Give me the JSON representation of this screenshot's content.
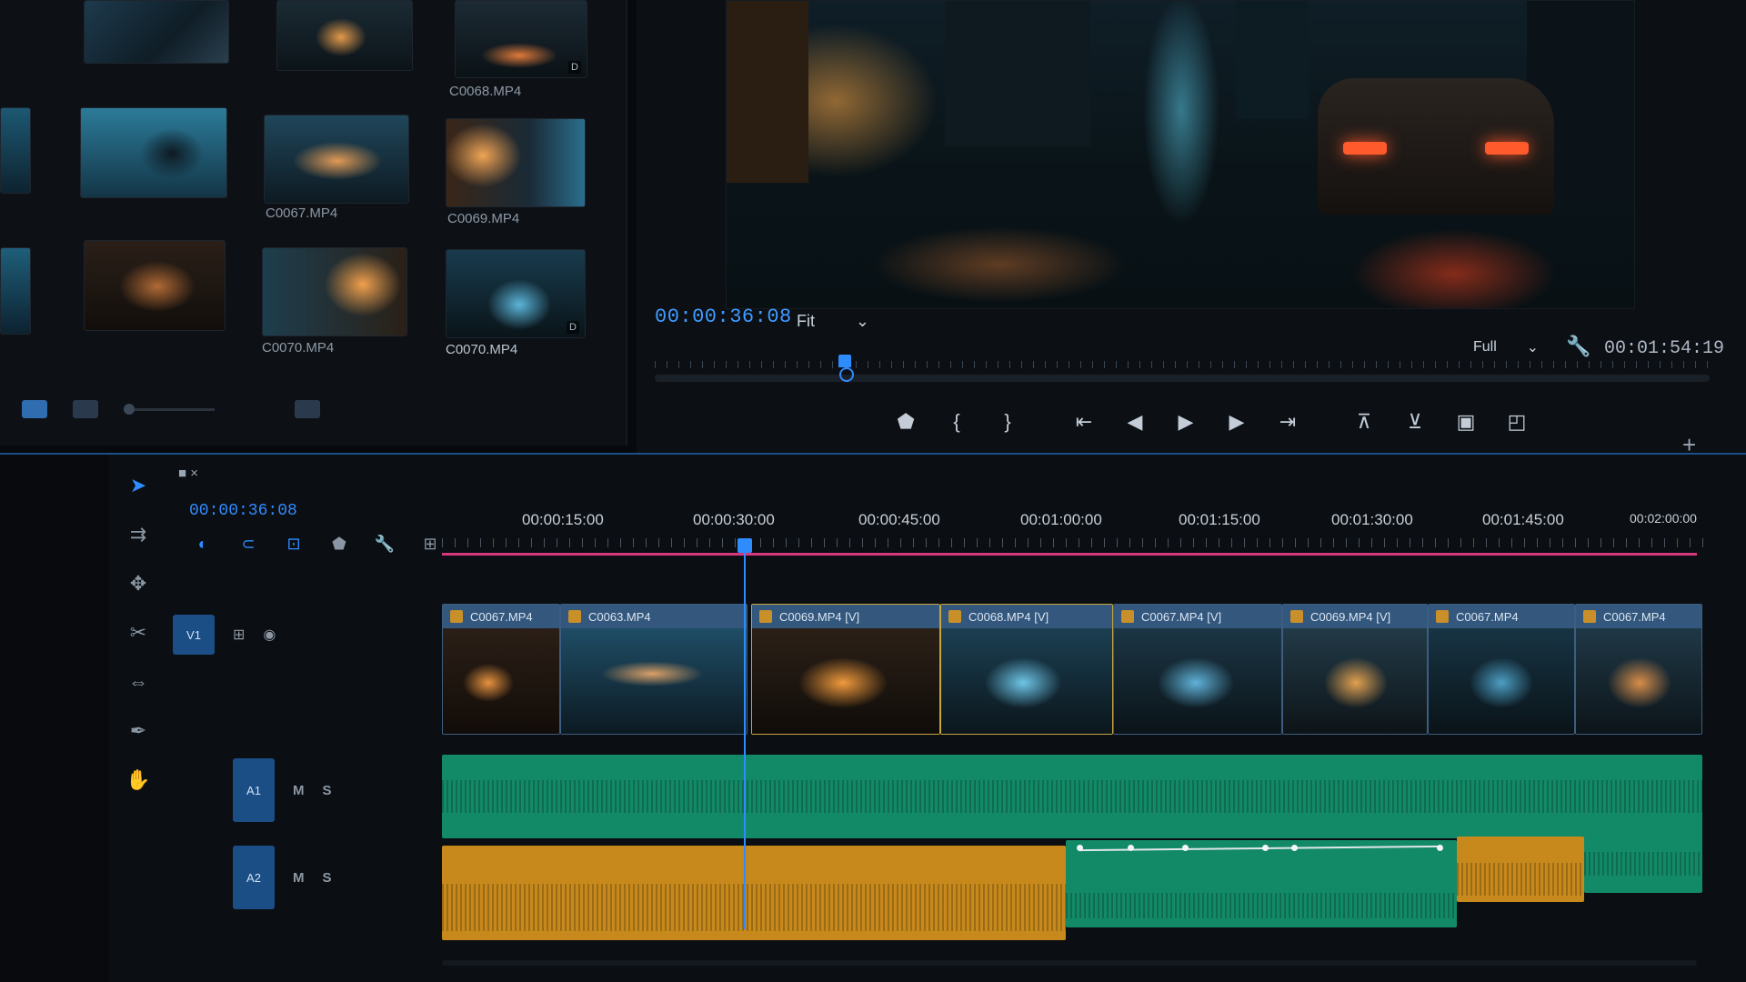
{
  "project_panel": {
    "thumbnails": [
      {
        "label": "",
        "badge": ""
      },
      {
        "label": "",
        "badge": ""
      },
      {
        "label": "C0068.MP4",
        "badge": "D"
      },
      {
        "label": "",
        "badge": ""
      },
      {
        "label": "C0067.MP4",
        "badge": ""
      },
      {
        "label": "C0069.MP4",
        "badge": ""
      },
      {
        "label": "",
        "badge": ""
      },
      {
        "label": "C0070.MP4",
        "badge": ""
      },
      {
        "label": "C0070.MP4",
        "badge": "D"
      }
    ]
  },
  "program_monitor": {
    "current_timecode": "00:00:36:08",
    "zoom": "Fit",
    "resolution": "Full",
    "duration_timecode": "00:01:54:19"
  },
  "timeline": {
    "sequence_timecode": "00:00:36:08",
    "ruler_labels": [
      "00:00:15:00",
      "00:00:30:00",
      "00:00:45:00",
      "00:01:00:00",
      "00:01:15:00",
      "00:01:30:00",
      "00:01:45:00",
      "00:02:00:00"
    ],
    "tracks": {
      "video": [
        "V1"
      ],
      "audio": [
        "A1",
        "A2"
      ]
    },
    "clips": [
      {
        "name": "C0067.MP4"
      },
      {
        "name": "C0063.MP4"
      },
      {
        "name": "C0069.MP4 [V]"
      },
      {
        "name": "C0068.MP4 [V]"
      },
      {
        "name": "C0067.MP4 [V]"
      },
      {
        "name": "C0069.MP4 [V]"
      },
      {
        "name": "C0067.MP4"
      },
      {
        "name": "C0067.MP4"
      }
    ]
  },
  "colors": {
    "accent": "#2f8cff",
    "work_area": "#d6377d",
    "audio_green": "#138a67",
    "audio_orange": "#c7891c",
    "clip_header": "#33577d"
  }
}
